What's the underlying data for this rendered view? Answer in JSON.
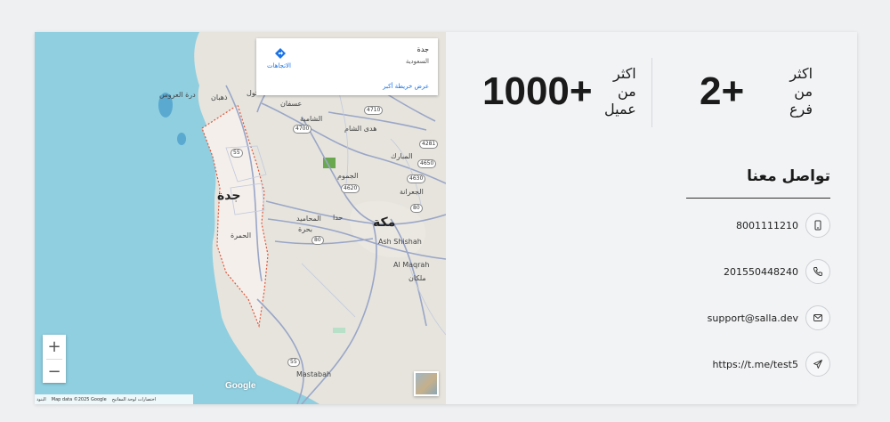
{
  "map": {
    "info_box": {
      "title": "جدة",
      "subtitle": "السعودية",
      "directions_label": "الاتجاهات",
      "larger_map_link": "عرض خريطة أكبر"
    },
    "labels": {
      "jeddah": "جدة",
      "makkah": "مكة",
      "ash_shishah": "Ash Shishah",
      "al_maqrah": "Al Maqrah",
      "mastabah": "Mastabah",
      "malkan": "ملكان",
      "al_hamra": "الحمرة",
      "al_mahamid": "المحاميد",
      "bahra": "بحرة",
      "hada": "حدا",
      "al_jumum": "الجموم",
      "al_jaranah": "الجعرانة",
      "al_mubarak": "المبارك",
      "hada_al_sham": "هدى الشام",
      "al_shamiya": "الشامية",
      "asfan": "عسفان",
      "dhahban": "ذهبان",
      "durrat_al_arous": "درة العروس",
      "thuwal": "ثول"
    },
    "shields": [
      "4710",
      "4700",
      "4281",
      "4650",
      "4630",
      "4620",
      "80",
      "55",
      "80",
      "55"
    ],
    "zoom_in": "+",
    "zoom_out": "−",
    "google_logo": "Google",
    "attribution": {
      "shortcuts": "اختصارات لوحة المفاتيح",
      "map_data": "Map data ©2025 Google",
      "terms": "البنود"
    }
  },
  "stats": {
    "branches": {
      "number": "2+",
      "line1": "اكثر",
      "line2": "من",
      "line3": "فرع"
    },
    "clients": {
      "number": "1000+",
      "line1": "اكثر",
      "line2": "من",
      "line3": "عميل"
    }
  },
  "contact": {
    "title": "تواصل معنا",
    "items": [
      {
        "text": "8001111210",
        "icon": "mobile-icon"
      },
      {
        "text": "201550448240",
        "icon": "phone-icon"
      },
      {
        "text": "support@salla.dev",
        "icon": "mail-icon"
      },
      {
        "text": "https://t.me/test5",
        "icon": "telegram-icon"
      }
    ]
  },
  "colors": {
    "sea": "#8fcfe0",
    "land": "#e6e4dd",
    "city_fill": "#f3eeea",
    "boundary": "#e0563a",
    "road": "#9aa6c7",
    "text_dark": "#1a1a1a"
  }
}
